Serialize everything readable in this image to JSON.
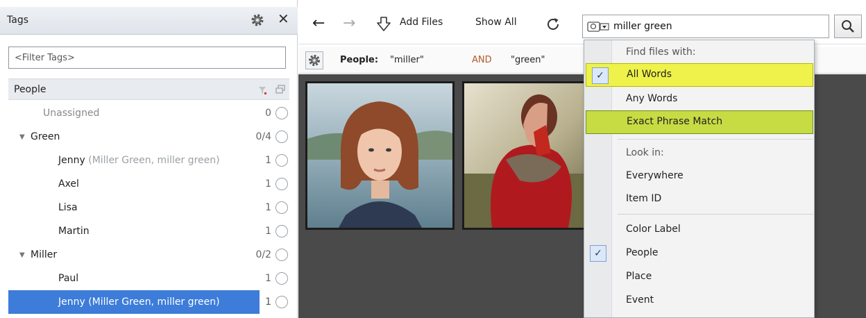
{
  "tags_panel": {
    "title": "Tags",
    "filter_placeholder": "<Filter Tags>",
    "section": "People",
    "rows": [
      {
        "label": "Unassigned",
        "alias": "",
        "count": "0"
      },
      {
        "label": "Green",
        "alias": "",
        "count": "0/4"
      },
      {
        "label": "Jenny",
        "alias": "(Miller Green, miller green)",
        "count": "1"
      },
      {
        "label": "Axel",
        "alias": "",
        "count": "1"
      },
      {
        "label": "Lisa",
        "alias": "",
        "count": "1"
      },
      {
        "label": "Martin",
        "alias": "",
        "count": "1"
      },
      {
        "label": "Miller",
        "alias": "",
        "count": "0/2"
      },
      {
        "label": "Paul",
        "alias": "",
        "count": "1"
      },
      {
        "label": "Jenny (Miller Green, miller green)",
        "alias": "",
        "count": "1"
      }
    ]
  },
  "toolbar": {
    "add_files": "Add Files",
    "show_all": "Show All",
    "search_value": "miller green"
  },
  "query_bar": {
    "field": "People:",
    "value1": "\"miller\"",
    "operator": "AND",
    "value2": "\"green\""
  },
  "dropdown": {
    "find_heading": "Find files with:",
    "all_words": "All Words",
    "any_words": "Any Words",
    "exact_phrase": "Exact Phrase Match",
    "look_heading": "Look in:",
    "everywhere": "Everywhere",
    "item_id": "Item ID",
    "color_label": "Color Label",
    "people": "People",
    "place": "Place",
    "event": "Event",
    "check_mark": "✓"
  },
  "icons": {
    "back": "←",
    "forward": "→",
    "close": "✕",
    "expanded": "▼"
  },
  "colors": {
    "selection": "#3d7cd8",
    "highlight_yellow": "#eef24a",
    "highlight_green": "#c7dc43",
    "operator": "#b25a2a"
  }
}
